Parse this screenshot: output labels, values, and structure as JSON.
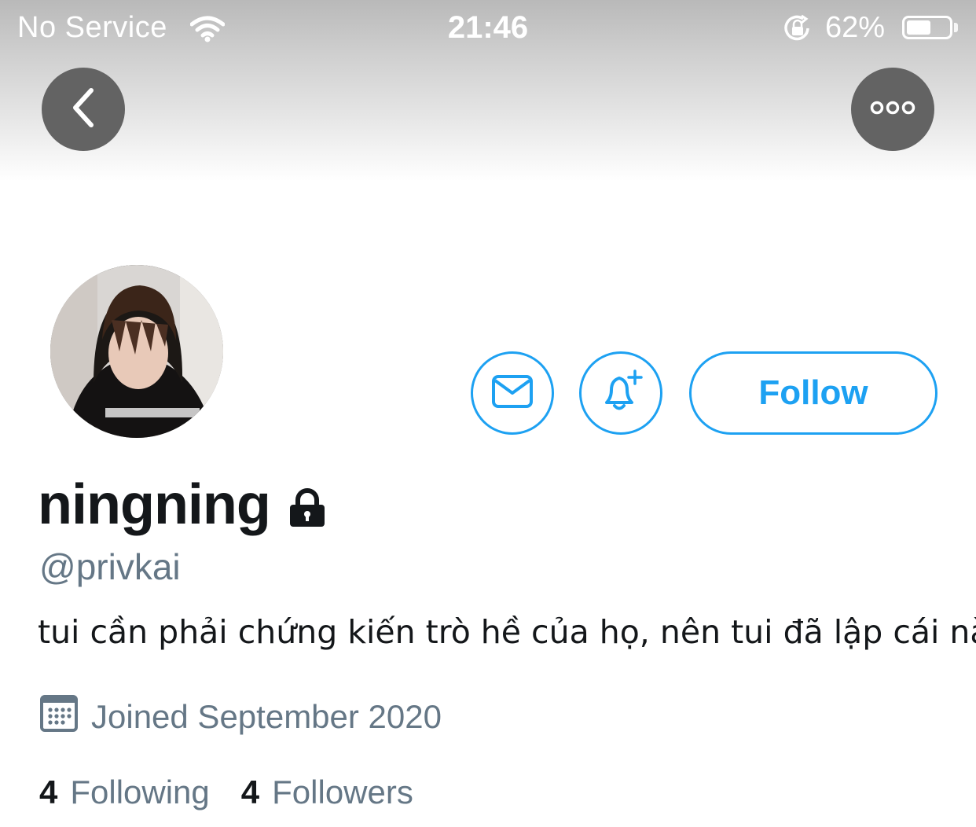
{
  "status_bar": {
    "carrier": "No Service",
    "time": "21:46",
    "battery_percent_label": "62%",
    "battery_level": 0.62,
    "icons": [
      "wifi-icon",
      "orientation-lock-icon",
      "battery-icon"
    ]
  },
  "header": {
    "back_icon": "chevron-left-icon",
    "more_icon": "more-horizontal-icon"
  },
  "profile": {
    "display_name": "ningning",
    "protected_icon": "lock-icon",
    "handle": "@privkai",
    "bio": "tui cần phải chứng kiến trò hề của họ, nên tui đã lập cái này",
    "joined": "Joined September 2020",
    "following_count": "4",
    "following_label": "Following",
    "followers_count": "4",
    "followers_label": "Followers"
  },
  "actions": {
    "message_icon": "envelope-icon",
    "notify_icon": "bell-plus-icon",
    "follow_label": "Follow"
  },
  "colors": {
    "accent": "#1da1f2",
    "secondary_text": "#657786",
    "primary_text": "#14171a",
    "nav_button_bg": "#636363"
  }
}
